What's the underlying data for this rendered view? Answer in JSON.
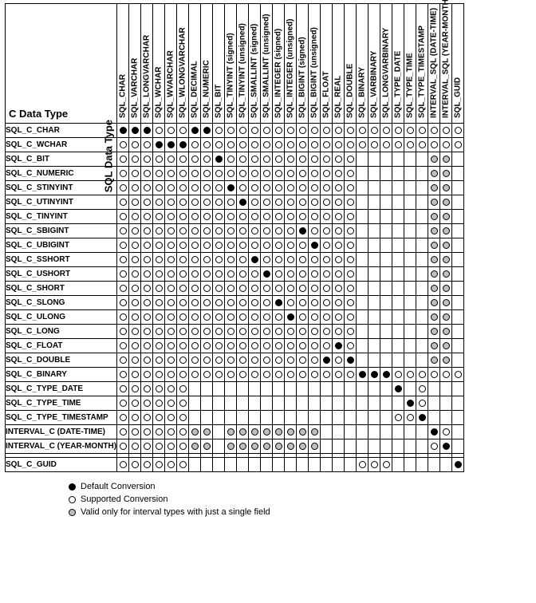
{
  "corner_row_label": "C Data Type",
  "corner_col_label": "SQL Data Type",
  "cols": [
    "SQL_CHAR",
    "SQL_VARCHAR",
    "SQL_LONGVARCHAR",
    "SQL_WCHAR",
    "SQL_WVARCHAR",
    "SQL_WLONGVARCHAR",
    "SQL_DECIMAL",
    "SQL_NUMERIC",
    "SQL_BIT",
    "SQL_TINYINT (signed)",
    "SQL_TINYINT (unsigned)",
    "SQL_SMALLINT (signed)",
    "SQL_SMALLINT (unsigned)",
    "SQL_INTEGER (signed)",
    "SQL_INTEGER (unsigned)",
    "SQL_BIGINT (signed)",
    "SQL_BIGINT (unsigned)",
    "SQL_FLOAT",
    "SQL_REAL",
    "SQL_DOUBLE",
    "SQL_BINARY",
    "SQL_VARBINARY",
    "SQL_LONGVARBINARY",
    "SQL_TYPE_DATE",
    "SQL_TYPE_TIME",
    "SQL_TYPE_TIMESTAMP",
    "INTERVAL_SQL (DATE-TIME)",
    "INTERVAL_SQL (YEAR-MONTH)",
    "SQL_GUID"
  ],
  "rows": [
    "SQL_C_CHAR",
    "SQL_C_WCHAR",
    "SQL_C_BIT",
    "SQL_C_NUMERIC",
    "SQL_C_STINYINT",
    "SQL_C_UTINYINT",
    "SQL_C_TINYINT",
    "SQL_C_SBIGINT",
    "SQL_C_UBIGINT",
    "SQL_C_SSHORT",
    "SQL_C_USHORT",
    "SQL_C_SHORT",
    "SQL_C_SLONG",
    "SQL_C_ULONG",
    "SQL_C_LONG",
    "SQL_C_FLOAT",
    "SQL_C_DOUBLE",
    "SQL_C_BINARY",
    "SQL_C_TYPE_DATE",
    "SQL_C_TYPE_TIME",
    "SQL_C_TYPE_TIMESTAMP",
    "INTERVAL_C (DATE-TIME)",
    "INTERVAL_C (YEAR-MONTH)",
    "_SPACER_",
    "SQL_C_GUID"
  ],
  "legend": {
    "default": "Default Conversion",
    "supported": "Supported Conversion",
    "interval": "Valid only for interval types with just a single field"
  },
  "chart_data": {
    "type": "heatmap",
    "symbol_meanings": {
      "D": "Default Conversion",
      "S": "Supported Conversion",
      "I": "Valid only for interval types with just a single field",
      ".": "blank"
    },
    "matrix": [
      "DDDSSSDDSSSSSSSSSSSSSSSSSSSSS",
      "SSSDDDSSSSSSSSSSSSSSSSSSSSSSS",
      "SSSSSSSSDSSSSSSSSSSS......II.",
      "SSSSSSSSSSSSSSSSSSSS......II.",
      "SSSSSSSSSDSSSSSSSSSS......II.",
      "SSSSSSSSSSDSSSSSSSSS......II.",
      "SSSSSSSSSSSSSSSSSSSS......II.",
      "SSSSSSSSSSSSSSSDSSSS......II.",
      "SSSSSSSSSSSSSSSSDSSS......II.",
      "SSSSSSSSSSSDSSSSSSSS......II.",
      "SSSSSSSSSSSSDSSSSSSS......II.",
      "SSSSSSSSSSSSSSSSSSSS......II.",
      "SSSSSSSSSSSSSDSSSSSS......II.",
      "SSSSSSSSSSSSSSDSSSSS......II.",
      "SSSSSSSSSSSSSSSSSSSS......II.",
      "SSSSSSSSSSSSSSSSSSDS......II.",
      "SSSSSSSSSSSSSSSSSDSD......II.",
      "SSSSSSSSSSSSSSSSSSSSDDDSSSSSS",
      "SSSSSS.................D.S...",
      "SSSSSS..................DS...",
      "SSSSSS.................SSD...",
      "SSSSSSII.IIIIIIII.........DS.",
      "SSSSSSII.IIIIIIII.........SD.",
      ".............................",
      "SSSSSS..............SSS.....D"
    ]
  }
}
